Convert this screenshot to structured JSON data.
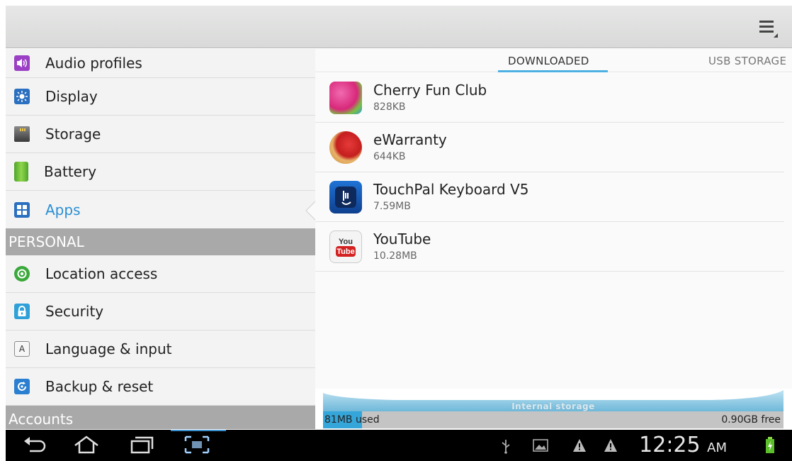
{
  "sidebar": {
    "items_top": [
      {
        "label": "Audio profiles",
        "icon": "audio-profiles-icon"
      },
      {
        "label": "Display",
        "icon": "display-icon"
      },
      {
        "label": "Storage",
        "icon": "storage-icon"
      },
      {
        "label": "Battery",
        "icon": "battery-icon"
      },
      {
        "label": "Apps",
        "icon": "apps-icon",
        "active": true
      }
    ],
    "personal_header": "PERSONAL",
    "items_personal": [
      {
        "label": "Location access",
        "icon": "location-icon"
      },
      {
        "label": "Security",
        "icon": "lock-icon"
      },
      {
        "label": "Language & input",
        "icon": "language-icon"
      },
      {
        "label": "Backup & reset",
        "icon": "backup-icon"
      }
    ],
    "accounts_header": "Accounts"
  },
  "tabs": {
    "downloaded": "DOWNLOADED",
    "usb": "USB STORAGE"
  },
  "apps": [
    {
      "name": "Cherry Fun Club",
      "size": "828KB",
      "icon": "cherry-fun-club-icon"
    },
    {
      "name": "eWarranty",
      "size": "644KB",
      "icon": "ewarranty-icon"
    },
    {
      "name": "TouchPal Keyboard V5",
      "size": "7.59MB",
      "icon": "touchpal-icon"
    },
    {
      "name": "YouTube",
      "size": "10.28MB",
      "icon": "youtube-icon"
    }
  ],
  "storage": {
    "label": "Internal storage",
    "used_value": "81MB",
    "used_suffix": " used",
    "free": "0.90GB free"
  },
  "statusbar": {
    "time": "12:25",
    "ampm": "AM"
  },
  "colors": {
    "accent": "#35a6d9",
    "header_gray": "#a9a9a9"
  }
}
